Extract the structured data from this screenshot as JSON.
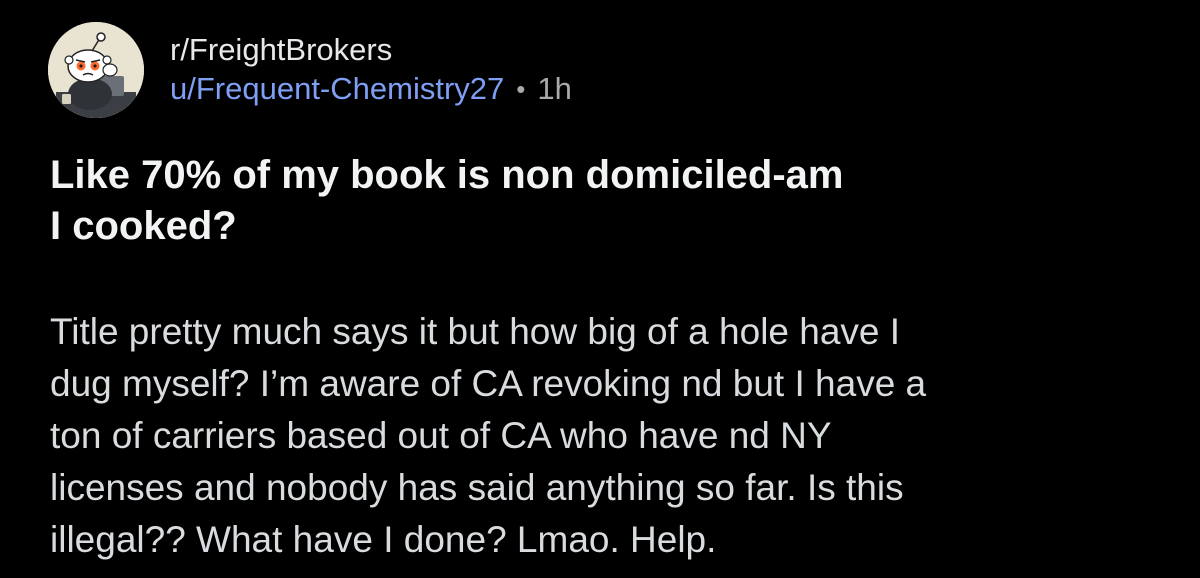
{
  "post": {
    "subreddit": "r/FreightBrokers",
    "author": "u/Frequent-Chemistry27",
    "separator": "•",
    "age": "1h",
    "avatar_icon": "reddit-snoo-avatar-icon",
    "title_lines": [
      "Like 70% of my book is non domiciled-am",
      "I cooked?"
    ],
    "body_lines": [
      "Title pretty much says it but how big of a hole have I",
      "dug myself? I’m aware of CA revoking nd but I have a",
      "ton of carriers based out of CA who have nd NY",
      "licenses and nobody has said anything so far. Is this",
      "illegal?? What have I done? Lmao. Help."
    ]
  },
  "colors": {
    "background": "#000000",
    "username": "#7f9ff5",
    "title": "#f2f3f4",
    "body_text": "#d9dcdf",
    "muted": "#a7a9ab"
  }
}
